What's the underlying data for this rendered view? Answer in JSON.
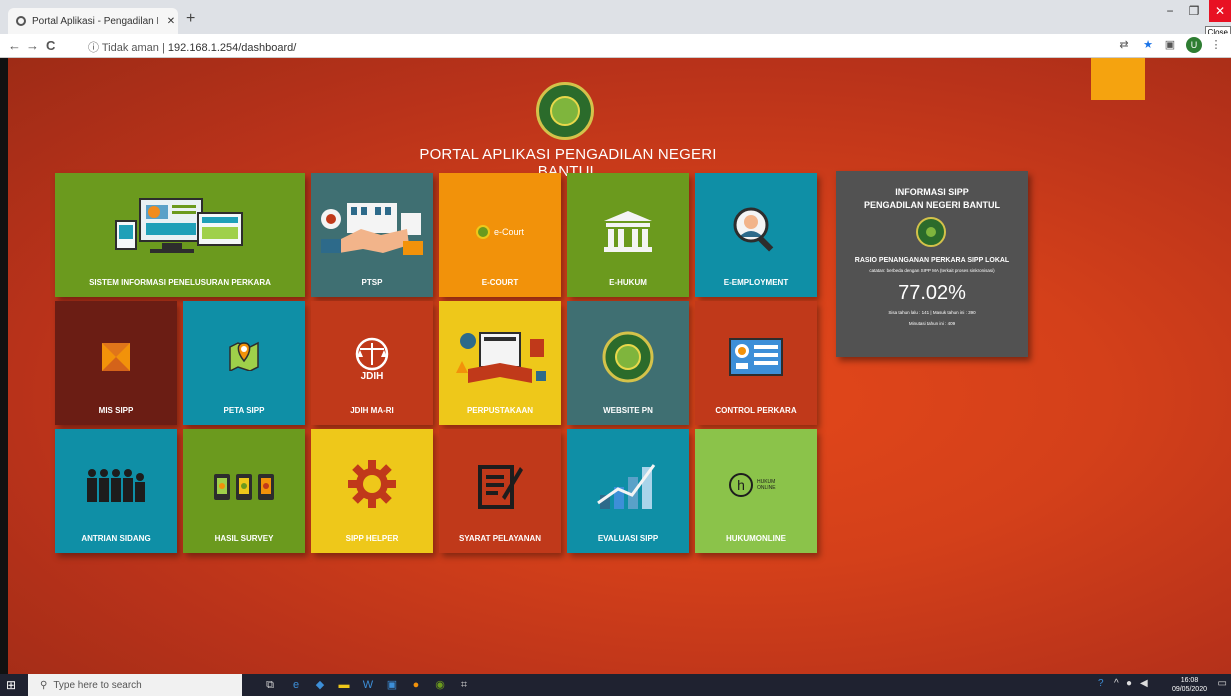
{
  "browser": {
    "tab_title": "Portal Aplikasi - Pengadilan Neg",
    "tab_close": "✕",
    "new_tab": "+",
    "tooltip": "Close",
    "url_security": "Tidak aman",
    "url_host": "192.168.1.254/dashboard/",
    "back": "←",
    "forward": "→",
    "reload": "C",
    "info": "ⓘ",
    "avatar_letter": "U"
  },
  "page": {
    "heading": "PORTAL APLIKASI PENGADILAN NEGERI BANTUL",
    "tiles": [
      {
        "label": "SISTEM INFORMASI PENELUSURAN PERKARA",
        "color": "#6b9a1e"
      },
      {
        "label": "PTSP",
        "color": "#3f6f72"
      },
      {
        "label": "E-COURT",
        "color": "#f2920a",
        "inner_text": "e-Court"
      },
      {
        "label": "E-HUKUM",
        "color": "#6b9a1e"
      },
      {
        "label": "E-EMPLOYMENT",
        "color": "#0f8fa6"
      },
      {
        "label": "MIS SIPP",
        "color": "#6b1d14"
      },
      {
        "label": "PETA SIPP",
        "color": "#0f8fa6"
      },
      {
        "label": "JDIH MA-RI",
        "color": "#c0391a",
        "inner_text": "JDIH"
      },
      {
        "label": "PERPUSTAKAAN",
        "color": "#eec81a"
      },
      {
        "label": "WEBSITE PN",
        "color": "#3f6f72"
      },
      {
        "label": "CONTROL PERKARA",
        "color": "#c0391a"
      },
      {
        "label": "ANTRIAN SIDANG",
        "color": "#0f8fa6"
      },
      {
        "label": "HASIL SURVEY",
        "color": "#6b9a1e"
      },
      {
        "label": "SIPP HELPER",
        "color": "#eec81a"
      },
      {
        "label": "SYARAT PELAYANAN",
        "color": "#c0391a"
      },
      {
        "label": "EVALUASI SIPP",
        "color": "#0f8fa6"
      },
      {
        "label": "HUKUMONLINE",
        "color": "#8bc34a",
        "inner_text": "HUKUM ONLINE"
      }
    ]
  },
  "info_panel": {
    "title_line1": "INFORMASI SIPP",
    "title_line2": "PENGADILAN NEGERI BANTUL",
    "rasio_label": "RASIO PENANGANAN PERKARA SIPP LOKAL",
    "catatan": "catatan: berbeda dengan SIPP MA (terkait proses sinkronisasi)",
    "percentage": "77.02%",
    "sisa_masuk": "Sisa tahun lalu : 141 | Masuk tahun ini : 390",
    "minutasi": "Minutasi tahun ini : 409"
  },
  "taskbar": {
    "search_placeholder": "Type here to search",
    "time": "16:08",
    "date": "09/05/2020"
  }
}
